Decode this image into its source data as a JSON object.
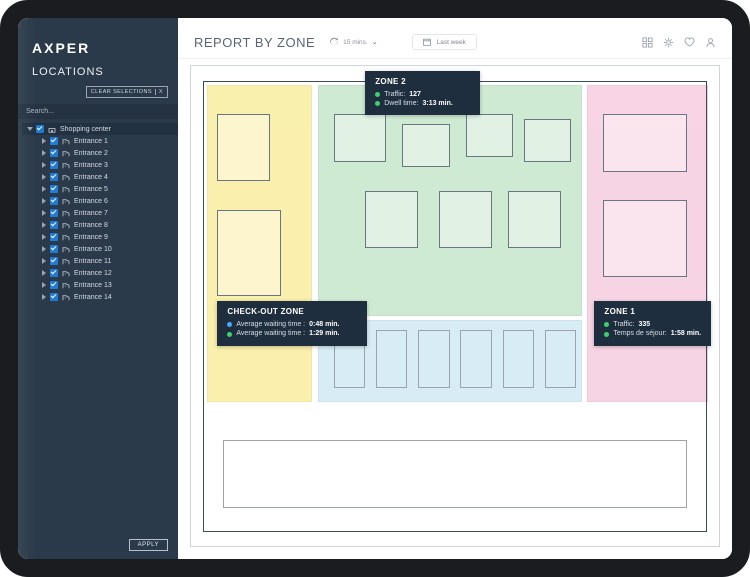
{
  "brand": "AXPER",
  "sidebar": {
    "section_title": "LOCATIONS",
    "clear_label": "CLEAR SELECTIONS",
    "clear_x": "X",
    "search_placeholder": "Search...",
    "apply_label": "APPLY",
    "root": {
      "label": "Shopping center"
    },
    "entrances": [
      {
        "label": "Entrance 1"
      },
      {
        "label": "Entrance 2"
      },
      {
        "label": "Entrance 3"
      },
      {
        "label": "Entrance 4"
      },
      {
        "label": "Entrance 5"
      },
      {
        "label": "Entrance 6"
      },
      {
        "label": "Entrance 7"
      },
      {
        "label": "Entrance 8"
      },
      {
        "label": "Entrance 9"
      },
      {
        "label": "Entrance 10"
      },
      {
        "label": "Entrance 11"
      },
      {
        "label": "Entrance 12"
      },
      {
        "label": "Entrance 13"
      },
      {
        "label": "Entrance 14"
      }
    ]
  },
  "header": {
    "title": "REPORT BY ZONE",
    "refresh_interval": "15 mins.",
    "period_label": "Last week"
  },
  "zones": {
    "zone2": {
      "title": "ZONE 2",
      "traffic_label": "Traffic:",
      "traffic_value": "127",
      "dwell_label": "Dwell time:",
      "dwell_value": "3:13 min."
    },
    "zone1": {
      "title": "ZONE 1",
      "traffic_label": "Traffic:",
      "traffic_value": "335",
      "sejour_label": "Temps de séjour:",
      "sejour_value": "1:58 min."
    },
    "checkout": {
      "title": "CHECK-OUT ZONE",
      "m1_label": "Average waiting time :",
      "m1_value": "0:48 min.",
      "m2_label": "Average waiting time :",
      "m2_value": "1:29 min."
    }
  },
  "colors": {
    "yellow": "#f6e36a",
    "green": "#a7d9b0",
    "pink": "#f2b1cf",
    "blue": "#b9def0",
    "panel": "#1f2e3e"
  }
}
